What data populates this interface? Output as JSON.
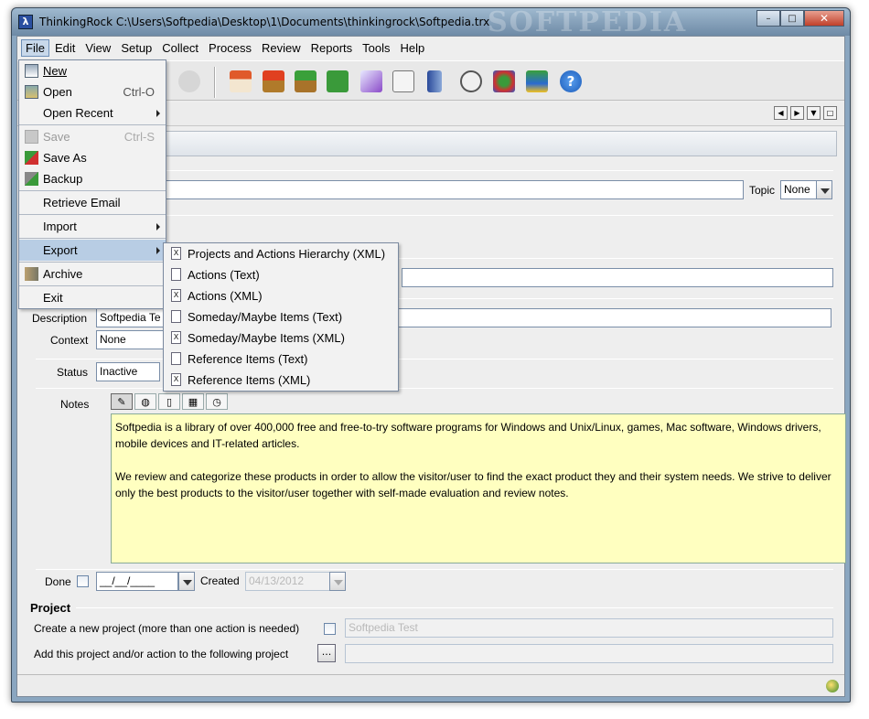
{
  "window": {
    "title": "ThinkingRock C:\\Users\\Softpedia\\Desktop\\1\\Documents\\thinkingrock\\Softpedia.trx",
    "watermark": "SOFTPEDIA",
    "minimize": "–",
    "maximize": "□",
    "close": "✕"
  },
  "menubar": [
    "File",
    "Edit",
    "View",
    "Setup",
    "Collect",
    "Process",
    "Review",
    "Reports",
    "Tools",
    "Help"
  ],
  "file_menu": {
    "items": [
      {
        "label": "New",
        "accel": "",
        "icon": "new-icon"
      },
      {
        "label": "Open",
        "accel": "Ctrl-O",
        "icon": "open-icon"
      },
      {
        "label": "Open Recent",
        "accel": "",
        "icon": ""
      },
      {
        "label": "Save",
        "accel": "Ctrl-S",
        "icon": "save-icon"
      },
      {
        "label": "Save As",
        "accel": "",
        "icon": "save-as-icon"
      },
      {
        "label": "Backup",
        "accel": "",
        "icon": "backup-icon"
      },
      {
        "label": "Retrieve Email",
        "accel": "",
        "icon": ""
      },
      {
        "label": "Import",
        "accel": "",
        "icon": ""
      },
      {
        "label": "Export",
        "accel": "",
        "icon": ""
      },
      {
        "label": "Archive",
        "accel": "",
        "icon": "archive-icon"
      },
      {
        "label": "Exit",
        "accel": "",
        "icon": ""
      }
    ]
  },
  "export_menu": {
    "items": [
      {
        "label": "Projects and Actions Hierarchy (XML)",
        "icon": "X"
      },
      {
        "label": "Actions (Text)",
        "icon": ""
      },
      {
        "label": "Actions (XML)",
        "icon": "X"
      },
      {
        "label": "Someday/Maybe Items (Text)",
        "icon": ""
      },
      {
        "label": "Someday/Maybe Items (XML)",
        "icon": "X"
      },
      {
        "label": "Reference Items (Text)",
        "icon": ""
      },
      {
        "label": "Reference Items (XML)",
        "icon": "X"
      }
    ]
  },
  "form": {
    "topic_label": "Topic",
    "topic_value": "None",
    "description_label": "Description",
    "description_value": "Softpedia Te",
    "context_label": "Context",
    "context_value": "None",
    "status_label": "Status",
    "status_value": "Inactive",
    "notes_label": "Notes",
    "notes_p1": "Softpedia is a library of over 400,000 free and free-to-try software programs for Windows and Unix/Linux, games, Mac software, Windows drivers, mobile devices and IT-related articles.",
    "notes_p2": "We review and categorize these products in order to allow the visitor/user to find the exact product they and their system needs. We strive to deliver only the best products to the visitor/user together with self-made evaluation and review notes.",
    "done_label": "Done",
    "done_date": "__/__/____",
    "created_label": "Created",
    "created_value": "04/13/2012"
  },
  "project": {
    "title": "Project",
    "create_label": "Create a new project (more than one action is needed)",
    "create_value": "Softpedia Test",
    "add_label": "Add this project and/or action to the following project",
    "add_button": "..."
  },
  "colors": {
    "notes_bg": "#ffffc0",
    "menu_highlight": "#b8cde4"
  }
}
